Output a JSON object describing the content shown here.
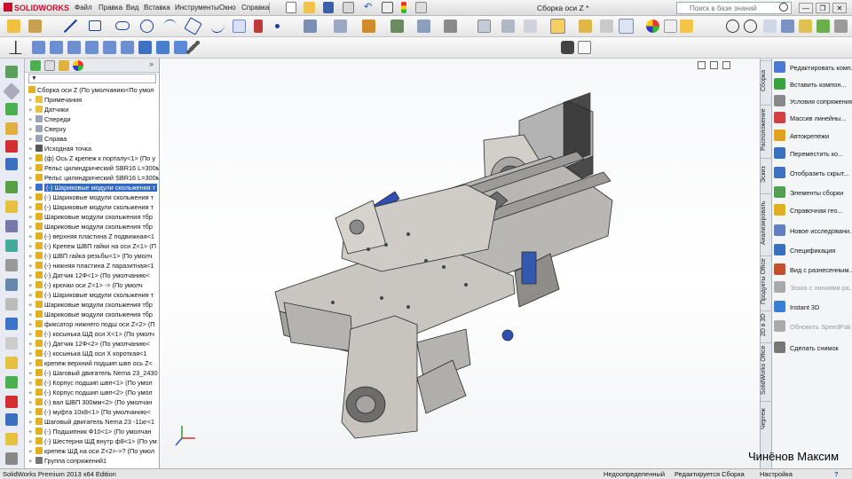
{
  "app": {
    "logo": "SOLIDWORKS",
    "doc_title": "Сборка оси Z *"
  },
  "menu": [
    "Файл",
    "Правка",
    "Вид",
    "Вставка",
    "Инструменты",
    "Окно",
    "Справка"
  ],
  "search": {
    "placeholder": "Поиск в базе знаний"
  },
  "window_buttons": [
    "—",
    "❐",
    "✕"
  ],
  "feature_tree": {
    "filter_symbol": "▼",
    "root": "Сборка оси Z  (По умолчанию<По умол",
    "items": [
      {
        "label": "Примечания",
        "icon": "annotation-icon",
        "color": "#e8c23a"
      },
      {
        "label": "Датчики",
        "icon": "sensor-icon",
        "color": "#e8c23a"
      },
      {
        "label": "Спереди",
        "icon": "plane-icon",
        "color": "#9aa4b4"
      },
      {
        "label": "Сверху",
        "icon": "plane-icon",
        "color": "#9aa4b4"
      },
      {
        "label": "Справа",
        "icon": "plane-icon",
        "color": "#9aa4b4"
      },
      {
        "label": "Исходная точка",
        "icon": "origin-icon",
        "color": "#555"
      },
      {
        "label": "(ф) Ось Z крепеж к порталу<1> (По у",
        "icon": "part-icon",
        "color": "#e0b020"
      },
      {
        "label": "Рельс цилиндрический SBR16 L=300м",
        "icon": "part-icon",
        "color": "#e0b020"
      },
      {
        "label": "Рельс цилиндрический SBR16 L=300м",
        "icon": "part-icon",
        "color": "#e0b020"
      },
      {
        "label": "(-) Шариковые модули скольжения т",
        "icon": "part-icon",
        "color": "#3a6fd0",
        "selected": true
      },
      {
        "label": "(-) Шариковые модули скольжения т",
        "icon": "part-icon",
        "color": "#e0b020"
      },
      {
        "label": "(-) Шариковые модули скольжения т",
        "icon": "part-icon",
        "color": "#e0b020"
      },
      {
        "label": "Шариковые модули скольжения тбр",
        "icon": "part-icon",
        "color": "#e0b020"
      },
      {
        "label": "Шариковые модули скольжения тбр",
        "icon": "part-icon",
        "color": "#e0b020"
      },
      {
        "label": "(-) верхняя пластина Z подвижная<1",
        "icon": "part-icon",
        "color": "#e0b020"
      },
      {
        "label": "(-) Крепеж ШВП гайки на оси Z<1> (П",
        "icon": "part-icon",
        "color": "#e0b020"
      },
      {
        "label": "(-) ШВП гайка резьбы<1> (По умолч",
        "icon": "part-icon",
        "color": "#e0b020"
      },
      {
        "label": "(-) нижняя пластина Z паразитная<1",
        "icon": "part-icon",
        "color": "#e0b020"
      },
      {
        "label": "(-) Датчик 12Ф<1> (По умолчанию<",
        "icon": "part-icon",
        "color": "#e0b020"
      },
      {
        "label": "(-) крючки оси Z<1> -> (По умолч",
        "icon": "part-icon",
        "color": "#e0b020"
      },
      {
        "label": "(-) Шариковые модули скольжения т",
        "icon": "part-icon",
        "color": "#e0b020"
      },
      {
        "label": "Шариковые модули скольжения тбр",
        "icon": "part-icon",
        "color": "#e0b020"
      },
      {
        "label": "Шариковые модули скольжения тбр",
        "icon": "part-icon",
        "color": "#e0b020"
      },
      {
        "label": "фиксатор нижнего подш оси Z<2> (П",
        "icon": "part-icon",
        "color": "#e0b020"
      },
      {
        "label": "(-) косынька ШД оси X<1> (По умолч",
        "icon": "part-icon",
        "color": "#e0b020"
      },
      {
        "label": "(-) Датчик 12Ф<2> (По умолчанию<",
        "icon": "part-icon",
        "color": "#e0b020"
      },
      {
        "label": "(-) косынька ШД оси X короткая<1",
        "icon": "part-icon",
        "color": "#e0b020"
      },
      {
        "label": "крепеж верхний подшип швп ось Z<",
        "icon": "part-icon",
        "color": "#e0b020"
      },
      {
        "label": "(-) Шаговый двигатель Nema 23_2430",
        "icon": "part-icon",
        "color": "#e0b020"
      },
      {
        "label": "(-) Корпус подшип швп<1> (По умол",
        "icon": "part-icon",
        "color": "#e0b020"
      },
      {
        "label": "(-) Корпус подшип швп<2> (По умол",
        "icon": "part-icon",
        "color": "#e0b020"
      },
      {
        "label": "(-) вал ШВП 300мм<2> (По умолчан",
        "icon": "part-icon",
        "color": "#e0b020"
      },
      {
        "label": "(-) муфта 10х8<1> (По умолчанию<",
        "icon": "part-icon",
        "color": "#e0b020"
      },
      {
        "label": "Шаговый двигатель Nema 23 -11кг<1",
        "icon": "part-icon",
        "color": "#e0b020"
      },
      {
        "label": "(-) Подшипник Ф10<1> (По умолчан",
        "icon": "part-icon",
        "color": "#e0b020"
      },
      {
        "label": "(-) Шестерня ШД внутр ф8<1> (По ум",
        "icon": "part-icon",
        "color": "#e0b020"
      },
      {
        "label": "крепеж ШД на оси Z<2>->? (По умол",
        "icon": "part-icon",
        "color": "#e0b020"
      },
      {
        "label": "Группа сопряжений1",
        "icon": "mates-icon",
        "color": "#777"
      }
    ]
  },
  "task_tabs": [
    "Сборка",
    "Расположение",
    "Эскиз",
    "Анализировать",
    "Продукты Office",
    "2D в 3D",
    "SolidWorks Office",
    "Чертеж"
  ],
  "task_pane": [
    {
      "label": "Редактировать комп...",
      "icon": "edit-component-icon",
      "color": "#4a7bd0"
    },
    {
      "label": "Вставить компон...",
      "icon": "insert-component-icon",
      "color": "#3aa040"
    },
    {
      "label": "Условия сопряжения",
      "icon": "mate-icon",
      "color": "#888"
    },
    {
      "label": "Массив линейны...",
      "icon": "linear-pattern-icon",
      "color": "#d04040"
    },
    {
      "label": "Автокрепежи",
      "icon": "smart-fasteners-icon",
      "color": "#e0a020"
    },
    {
      "label": "Переместить ко...",
      "icon": "move-component-icon",
      "color": "#3a70c0"
    },
    {
      "label": "Отобразить скрыт...",
      "icon": "show-hidden-icon",
      "color": "#4070c0"
    },
    {
      "label": "Элементы сборки",
      "icon": "assembly-features-icon",
      "color": "#50a050"
    },
    {
      "label": "Справочная гео...",
      "icon": "reference-geometry-icon",
      "color": "#e0b020"
    },
    {
      "label": "Новое исследовани...",
      "icon": "motion-study-icon",
      "color": "#6080c0"
    },
    {
      "label": "Спецификация",
      "icon": "bom-icon",
      "color": "#3a70c0"
    },
    {
      "label": "Вид с разнесенным...",
      "icon": "exploded-view-icon",
      "color": "#c05030"
    },
    {
      "label": "Эскиз с линиями ра...",
      "icon": "explode-line-sketch-icon",
      "color": "#aaa",
      "dim": true
    },
    {
      "label": "Instant 3D",
      "icon": "instant3d-icon",
      "color": "#3a80d0"
    },
    {
      "label": "Обновить SpeedPak",
      "icon": "speedpak-icon",
      "color": "#aaa",
      "dim": true
    },
    {
      "label": "Сделать снимок",
      "icon": "snapshot-icon",
      "color": "#777"
    }
  ],
  "statusbar": {
    "left": "SolidWorks Premium 2013 x64 Edition",
    "status": "Недоопределенный",
    "mode": "Редактируется Сборка",
    "settings": "Настройка",
    "help": "?"
  },
  "watermark": "Чинёнов Максим",
  "colors": {
    "accent": "#316ac5",
    "brand": "#c8102e",
    "model": "#c9c6c2"
  }
}
